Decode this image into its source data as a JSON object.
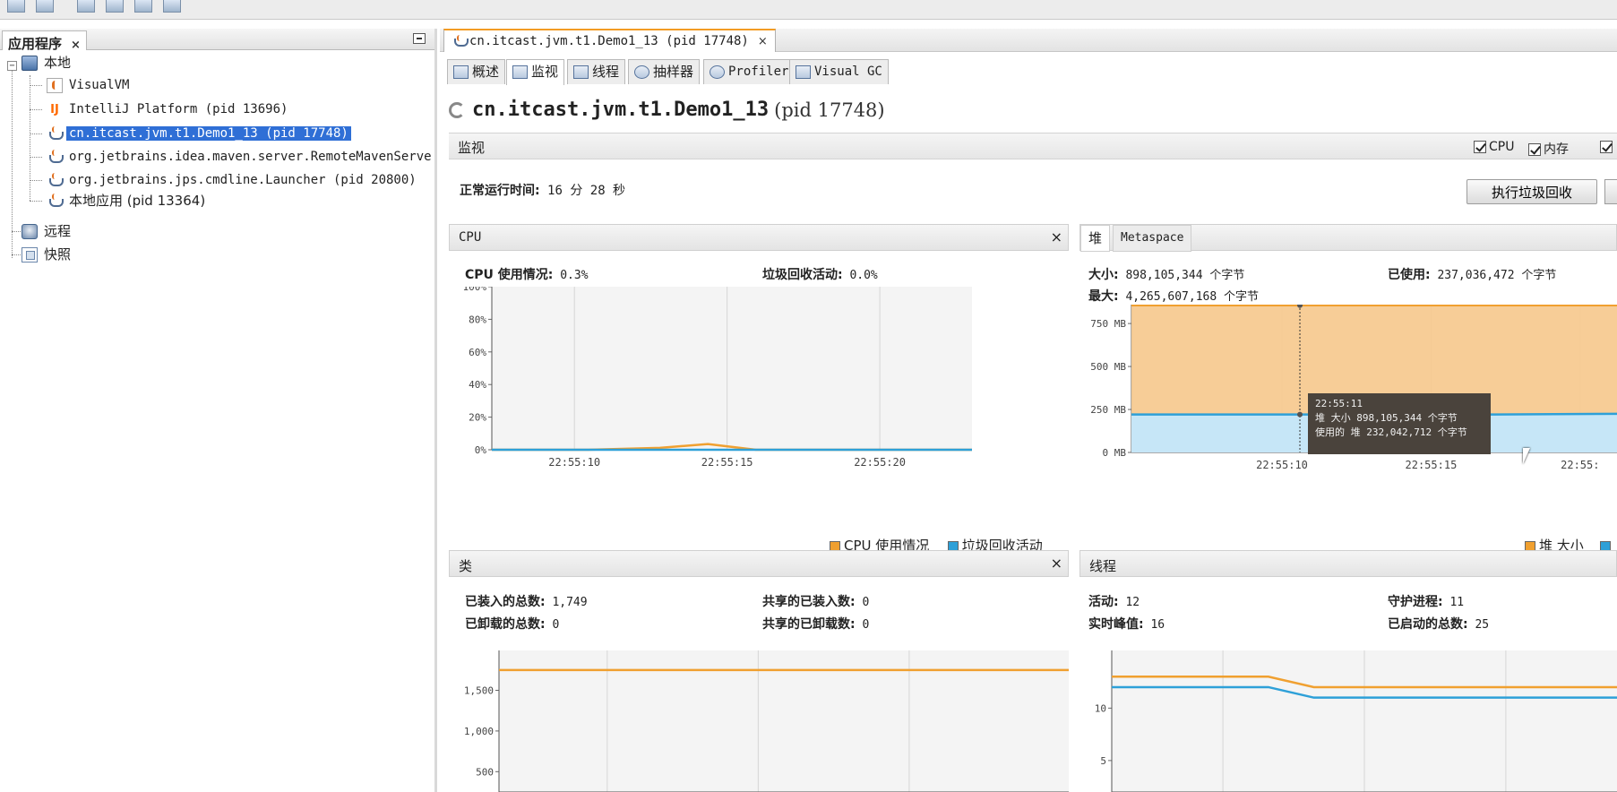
{
  "left_panel": {
    "tab_title": "应用程序",
    "tab_close": "×",
    "tree": [
      {
        "label": "本地",
        "icon": "local-host-icon"
      },
      {
        "label": "VisualVM",
        "icon": "visualvm-icon"
      },
      {
        "label": "IntelliJ Platform (pid 13696)",
        "icon": "intellij-icon"
      },
      {
        "label": "cn.itcast.jvm.t1.Demo1_13 (pid 17748)",
        "icon": "java-app-icon",
        "selected": true
      },
      {
        "label": "org.jetbrains.idea.maven.server.RemoteMavenServe",
        "icon": "java-app-icon"
      },
      {
        "label": "org.jetbrains.jps.cmdline.Launcher (pid 20800)",
        "icon": "java-app-icon"
      },
      {
        "label": "本地应用 (pid 13364)",
        "icon": "java-app-icon"
      },
      {
        "label": "远程",
        "icon": "remote-icon"
      },
      {
        "label": "快照",
        "icon": "snapshot-icon"
      }
    ]
  },
  "doc_tab": {
    "label": "cn.itcast.jvm.t1.Demo1_13 (pid 17748)",
    "close": "×"
  },
  "view_tabs": [
    {
      "label": "概述",
      "icon": "overview-icon"
    },
    {
      "label": "监视",
      "icon": "monitor-icon",
      "active": true
    },
    {
      "label": "线程",
      "icon": "threads-icon"
    },
    {
      "label": "抽样器",
      "icon": "sampler-icon"
    },
    {
      "label": "Profiler",
      "icon": "profiler-icon"
    },
    {
      "label": "Visual GC",
      "icon": "visual-gc-icon"
    }
  ],
  "app": {
    "title": "cn.itcast.jvm.t1.Demo1_13",
    "pid": "(pid 17748)"
  },
  "monitor": {
    "title": "监视",
    "checkboxes": [
      {
        "label": "CPU",
        "checked": true
      },
      {
        "label": "内存",
        "checked": true
      },
      {
        "label": "",
        "checked": true
      }
    ],
    "uptime_label": "正常运行时间:",
    "uptime_value": "16 分 28 秒",
    "gc_button": "执行垃圾回收"
  },
  "cpu_panel": {
    "title": "CPU",
    "close": "×",
    "usage_label": "CPU 使用情况:",
    "usage_value": "0.3%",
    "gc_label": "垃圾回收活动:",
    "gc_value": "0.0%",
    "legend": [
      {
        "label": "CPU 使用情况",
        "color": "#f0a030"
      },
      {
        "label": "垃圾回收活动",
        "color": "#2ea0d8"
      }
    ]
  },
  "heap_panel": {
    "tabs": [
      "堆",
      "Metaspace"
    ],
    "size_label": "大小:",
    "size_value": "898,105,344 个字节",
    "used_label": "已使用:",
    "used_value": "237,036,472 个字节",
    "max_label": "最大:",
    "max_value": "4,265,607,168 个字节",
    "tooltip": {
      "time": "22:55:11",
      "line1": "堆 大小    898,105,344 个字节",
      "line2": "使用的 堆  232,042,712 个字节"
    },
    "legend": [
      {
        "label": "堆 大小",
        "color": "#f0a030"
      },
      {
        "label": "",
        "color": "#2ea0d8"
      }
    ]
  },
  "classes_panel": {
    "title": "类",
    "close": "×",
    "loaded_label": "已装入的总数:",
    "loaded_value": "1,749",
    "shared_loaded_label": "共享的已装入数:",
    "shared_loaded_value": "0",
    "unloaded_label": "已卸载的总数:",
    "unloaded_value": "0",
    "shared_unloaded_label": "共享的已卸载数:",
    "shared_unloaded_value": "0"
  },
  "threads_panel": {
    "title": "线程",
    "live_label": "活动:",
    "live_value": "12",
    "daemon_label": "守护进程:",
    "daemon_value": "11",
    "peak_label": "实时峰值:",
    "peak_value": "16",
    "started_label": "已启动的总数:",
    "started_value": "25"
  },
  "chart_data": [
    {
      "type": "line",
      "name": "cpu",
      "x_ticks": [
        "22:55:10",
        "22:55:15",
        "22:55:20"
      ],
      "y_ticks": [
        "100%",
        "80%",
        "60%",
        "40%",
        "20%",
        "0%"
      ],
      "ylim": [
        0,
        100
      ],
      "series": [
        {
          "name": "CPU 使用情况",
          "color": "#f0a030",
          "x": [
            0,
            0.2,
            0.35,
            0.45,
            0.55,
            1.0
          ],
          "values": [
            0,
            0,
            1.2,
            3.5,
            0,
            0
          ]
        },
        {
          "name": "垃圾回收活动",
          "color": "#2ea0d8",
          "x": [
            0,
            1.0
          ],
          "values": [
            0,
            0
          ]
        }
      ]
    },
    {
      "type": "area",
      "name": "heap",
      "x_ticks": [
        "22:55:10",
        "22:55:15",
        "22:55:"
      ],
      "y_ticks": [
        "750 MB",
        "500 MB",
        "250 MB",
        "0 MB"
      ],
      "ylim": [
        0,
        860
      ],
      "series": [
        {
          "name": "堆 大小",
          "color": "#f0a030",
          "values": [
            856,
            856,
            856,
            856,
            856
          ]
        },
        {
          "name": "使用的 堆",
          "color": "#2ea0d8",
          "values": [
            221,
            221,
            221,
            221,
            225
          ]
        }
      ]
    },
    {
      "type": "line",
      "name": "classes",
      "y_ticks": [
        "1,500",
        "1,000",
        "500"
      ],
      "ylim": [
        250,
        1990
      ],
      "series": [
        {
          "name": "已装入的总数",
          "color": "#f0a030",
          "values": [
            1749,
            1749
          ]
        }
      ]
    },
    {
      "type": "line",
      "name": "threads",
      "y_ticks": [
        "10",
        "5"
      ],
      "ylim": [
        2,
        15.5
      ],
      "series": [
        {
          "name": "活动",
          "color": "#2ea0d8",
          "x": [
            0,
            0.31,
            0.4,
            1.0
          ],
          "values": [
            12,
            12,
            11,
            11
          ]
        },
        {
          "name": "实时峰值",
          "color": "#f0a030",
          "x": [
            0,
            0.31,
            0.4,
            1.0
          ],
          "values": [
            13,
            13,
            12,
            12
          ]
        }
      ]
    }
  ]
}
